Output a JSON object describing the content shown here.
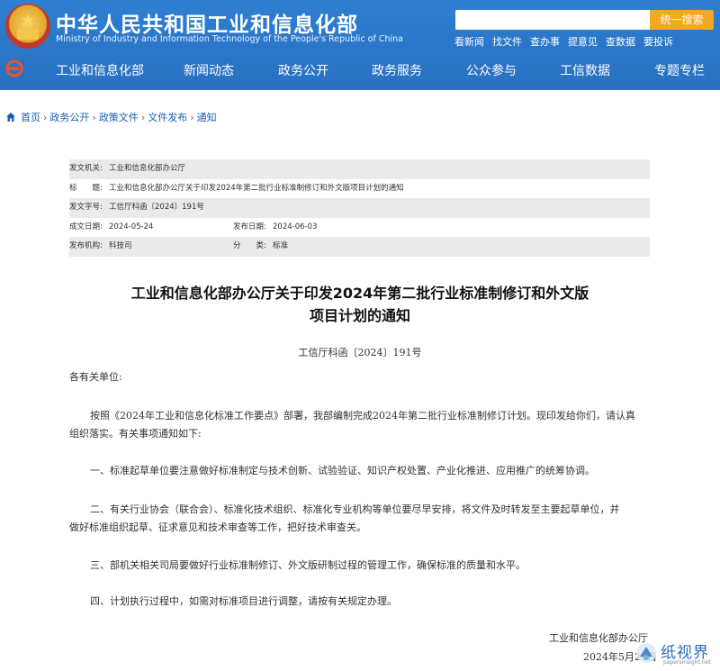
{
  "header": {
    "title_cn": "中华人民共和国工业和信息化部",
    "title_en": "Ministry of Industry and Information Technology of the People's Republic of China",
    "search_placeholder": "",
    "search_button": "统一搜索",
    "quick_links": [
      "看新闻",
      "找文件",
      "查办事",
      "提意见",
      "查数据",
      "要投诉"
    ]
  },
  "nav": {
    "items": [
      "工业和信息化部",
      "新闻动态",
      "政务公开",
      "政务服务",
      "公众参与",
      "工信数据",
      "专题专栏"
    ]
  },
  "breadcrumb": [
    "首页",
    "政务公开",
    "政策文件",
    "文件发布",
    "通知"
  ],
  "info_table": {
    "rows": [
      {
        "label": "发文机关:",
        "value": "工业和信息化部办公厅"
      },
      {
        "label": "标　　题:",
        "value": "工业和信息化部办公厅关于印发2024年第二批行业标准制修订和外文版项目计划的通知"
      },
      {
        "label": "发文字号:",
        "value": "工信厅科函〔2024〕191号"
      },
      {
        "label": "成文日期:",
        "value": "2024-05-24",
        "label2": "发布日期:",
        "value2": "2024-06-03"
      },
      {
        "label": "发布机构:",
        "value": "科技司",
        "label2": "分　　类:",
        "value2": "标准"
      }
    ]
  },
  "document": {
    "title_line1": "工业和信息化部办公厅关于印发2024年第二批行业标准制修订和外文版",
    "title_line2": "项目计划的通知",
    "doc_number": "工信厅科函〔2024〕191号",
    "salutation": "各有关单位:",
    "para1_line1": "按照《2024年工业和信息化标准工作要点》部署，我部编制完成2024年第二批行业标准制修订计划。现印发给你们，请认真",
    "para1_line2": "组织落实。有关事项通知如下:",
    "item1": "一、标准起草单位要注意做好标准制定与技术创新、试验验证、知识产权处置、产业化推进、应用推广的统筹协调。",
    "item2_line1": "二、有关行业协会（联合会）、标准化技术组织、标准化专业机构等单位要尽早安排，将文件及时转发至主要起草单位，并",
    "item2_line2": "做好标准组织起草、征求意见和技术审查等工作，把好技术审查关。",
    "item3": "三、部机关相关司局要做好行业标准制修订、外文版研制过程的管理工作，确保标准的质量和水平。",
    "item4": "四、计划执行过程中，如需对标准项目进行调整，请按有关规定办理。",
    "signature": "工业和信息化部办公厅",
    "date": "2024年5月24日"
  },
  "watermark": {
    "text": "纸视界",
    "url": "papersinsight.net"
  },
  "colors": {
    "header_blue": "#2a76c8",
    "search_button": "#f5a623",
    "link_blue": "#1a5fb4",
    "row_shade": "#eaeaea"
  }
}
